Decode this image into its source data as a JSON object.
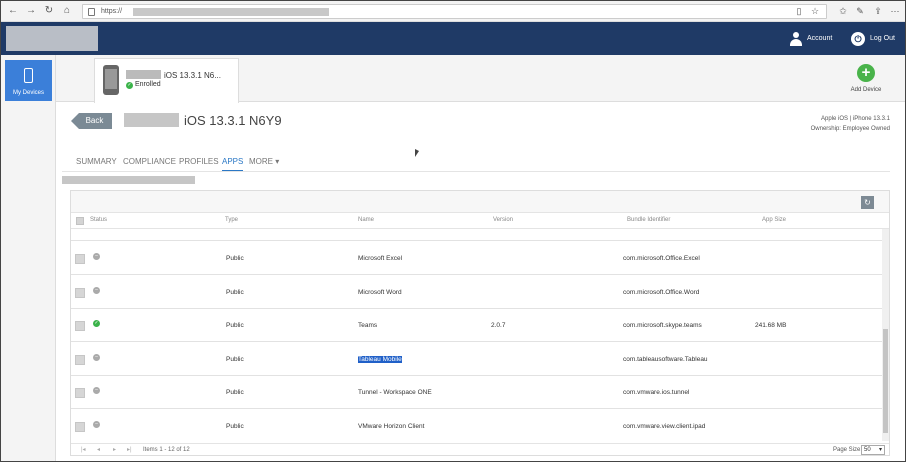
{
  "browser": {
    "url_prefix": "https://",
    "icons": {
      "back": "arrow-left-icon",
      "forward": "arrow-right-icon",
      "reload": "reload-icon",
      "home": "home-icon",
      "reading": "reading-view-icon",
      "favorite": "star-icon",
      "favorites": "favorites-icon",
      "pen": "pen-icon",
      "share": "share-icon",
      "more": "more-icon"
    }
  },
  "header": {
    "account_label": "Account",
    "logout_label": "Log Out"
  },
  "leftrail": {
    "my_devices_label": "My Devices"
  },
  "device_tab": {
    "name": "iOS 13.3.1 N6...",
    "status": "Enrolled"
  },
  "add_device": {
    "label": "Add Device",
    "glyph": "+"
  },
  "page": {
    "back_label": "Back",
    "title": "iOS 13.3.1 N6Y9",
    "device_info_line1": "Apple iOS | iPhone 13.3.1",
    "device_info_line2": "Ownership: Employee Owned"
  },
  "tabs": [
    {
      "label": "SUMMARY"
    },
    {
      "label": "COMPLIANCE"
    },
    {
      "label": "PROFILES"
    },
    {
      "label": "APPS"
    },
    {
      "label": "MORE ▾"
    }
  ],
  "table": {
    "columns": [
      "Status",
      "Type",
      "Name",
      "Version",
      "Bundle Identifier",
      "App Size"
    ],
    "rows": [
      {
        "status": "neutral",
        "type": "Public",
        "name": "Microsoft Excel",
        "version": "",
        "bundle": "com.microsoft.Office.Excel",
        "size": ""
      },
      {
        "status": "neutral",
        "type": "Public",
        "name": "Microsoft Word",
        "version": "",
        "bundle": "com.microsoft.Office.Word",
        "size": ""
      },
      {
        "status": "installed",
        "type": "Public",
        "name": "Teams",
        "version": "2.0.7",
        "bundle": "com.microsoft.skype.teams",
        "size": "241.68 MB"
      },
      {
        "status": "neutral",
        "type": "Public",
        "name": "Tableau Mobile",
        "version": "",
        "bundle": "com.tableausoftware.Tableau",
        "size": ""
      },
      {
        "status": "neutral",
        "type": "Public",
        "name": "Tunnel - Workspace ONE",
        "version": "",
        "bundle": "com.vmware.ios.tunnel",
        "size": ""
      },
      {
        "status": "neutral",
        "type": "Public",
        "name": "VMware Horizon Client",
        "version": "",
        "bundle": "com.vmware.view.client.ipad",
        "size": ""
      }
    ]
  },
  "pager": {
    "info": "Items 1 - 12 of 12",
    "page_size_label": "Page Size:",
    "page_size_value": "50"
  }
}
